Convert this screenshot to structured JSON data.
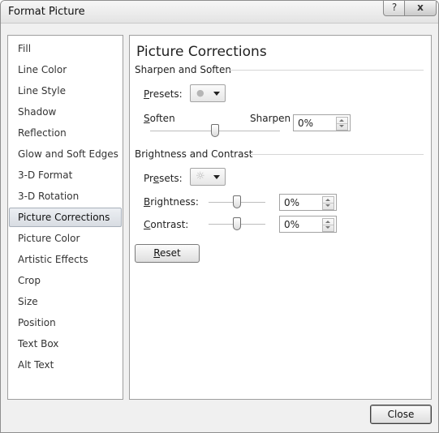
{
  "window": {
    "title": "Format Picture",
    "help_glyph": "?",
    "close_glyph": "x"
  },
  "nav": {
    "items": [
      {
        "label": "Fill"
      },
      {
        "label": "Line Color"
      },
      {
        "label": "Line Style"
      },
      {
        "label": "Shadow"
      },
      {
        "label": "Reflection"
      },
      {
        "label": "Glow and Soft Edges"
      },
      {
        "label": "3-D Format"
      },
      {
        "label": "3-D Rotation"
      },
      {
        "label": "Picture Corrections"
      },
      {
        "label": "Picture Color"
      },
      {
        "label": "Artistic Effects"
      },
      {
        "label": "Crop"
      },
      {
        "label": "Size"
      },
      {
        "label": "Position"
      },
      {
        "label": "Text Box"
      },
      {
        "label": "Alt Text"
      }
    ],
    "selected": "Picture Corrections"
  },
  "panel": {
    "title": "Picture Corrections",
    "sharpen": {
      "group_label": "Sharpen and Soften",
      "presets_key": "P",
      "presets_rest": "resets:",
      "soften_key": "S",
      "soften_rest": "often",
      "sharpen_label": "Sharpen",
      "value": "0%",
      "slider_level": 0.5
    },
    "brightness_contrast": {
      "group_label": "Brightness and Contrast",
      "presets_pre": "Pr",
      "presets_key": "e",
      "presets_rest": "sets:",
      "brightness_key": "B",
      "brightness_rest": "rightness:",
      "brightness_value": "0%",
      "brightness_level": 0.5,
      "contrast_key": "C",
      "contrast_rest": "ontrast:",
      "contrast_value": "0%",
      "contrast_level": 0.5
    },
    "reset_key": "R",
    "reset_rest": "eset"
  },
  "footer": {
    "close_label": "Close"
  },
  "icons": {
    "sharpen_preset": "dot-preset-icon",
    "brightness_preset": "sun-preset-icon"
  }
}
